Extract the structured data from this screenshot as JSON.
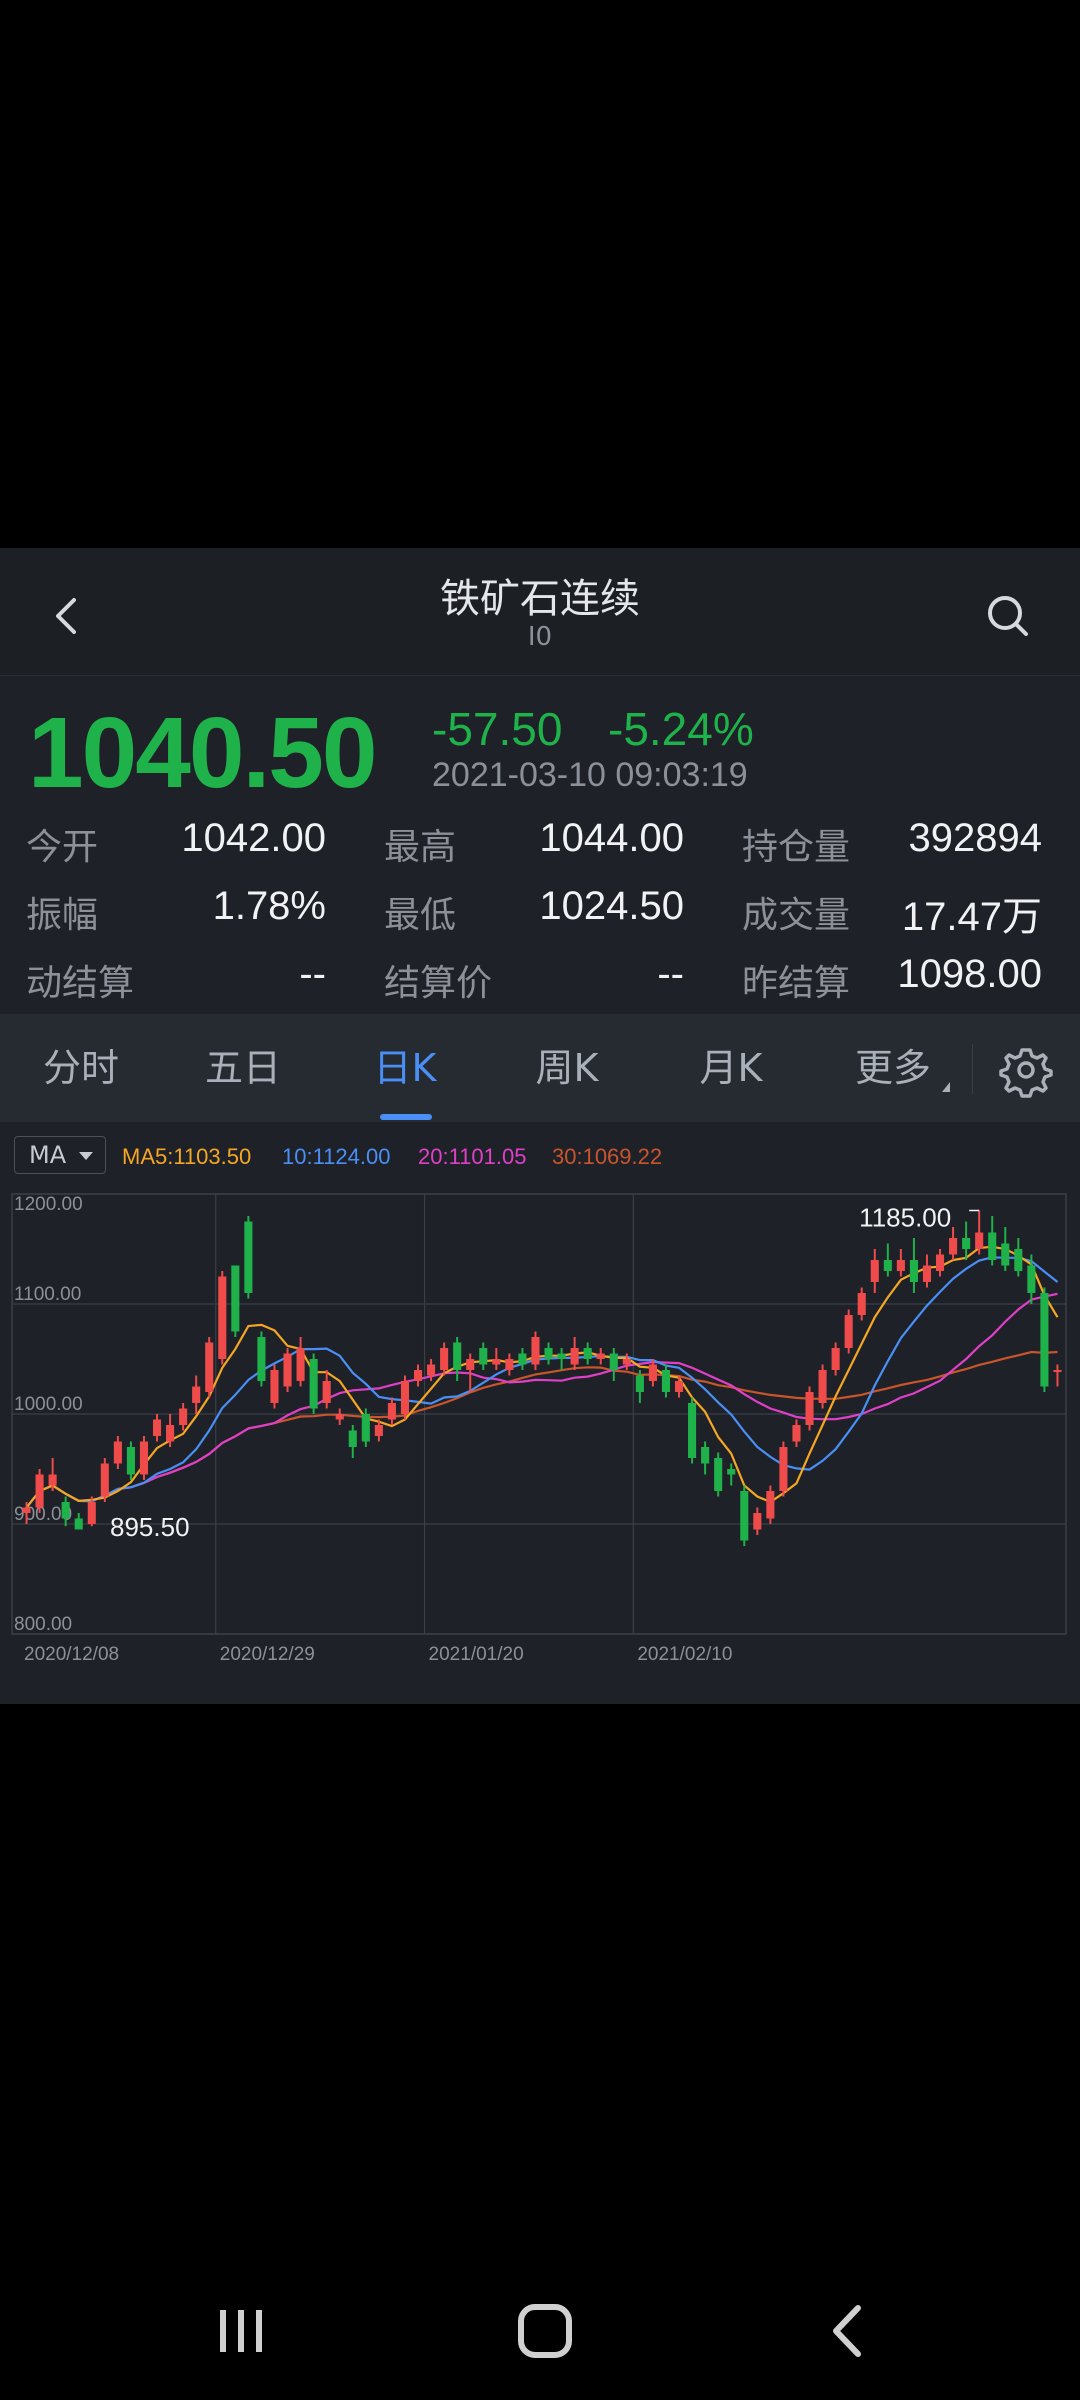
{
  "header": {
    "title": "铁矿石连续",
    "subtitle": "I0"
  },
  "quote": {
    "price": "1040.50",
    "change": "-57.50",
    "change_pct": "-5.24%",
    "time": "2021-03-10 09:03:19",
    "colors": {
      "down": "#1fb24a",
      "up": "#ef4b4b"
    },
    "stats": [
      [
        {
          "label": "今开",
          "value": "1042.00"
        },
        {
          "label": "最高",
          "value": "1044.00"
        },
        {
          "label": "持仓量",
          "value": "392894"
        }
      ],
      [
        {
          "label": "振幅",
          "value": "1.78%"
        },
        {
          "label": "最低",
          "value": "1024.50"
        },
        {
          "label": "成交量",
          "value": "17.47万"
        }
      ],
      [
        {
          "label": "动结算",
          "value": "--"
        },
        {
          "label": "结算价",
          "value": "--"
        },
        {
          "label": "昨结算",
          "value": "1098.00"
        }
      ]
    ]
  },
  "tabs": [
    "分时",
    "五日",
    "日K",
    "周K",
    "月K",
    "更多"
  ],
  "active_tab": "日K",
  "ma": {
    "selector": "MA",
    "legend": [
      {
        "text": "MA5:1103.50",
        "color": "#f5a623"
      },
      {
        "text": "10:1124.00",
        "color": "#4a8ff5"
      },
      {
        "text": "20:1101.05",
        "color": "#e040c8"
      },
      {
        "text": "30:1069.22",
        "color": "#c9552c"
      }
    ]
  },
  "chart_data": {
    "type": "candlestick",
    "ylim": [
      800,
      1200
    ],
    "y_ticks": [
      "1200.00",
      "1100.00",
      "1000.00",
      "900.00",
      "800.00"
    ],
    "x_ticks": [
      "2020/12/08",
      "2020/12/29",
      "2021/01/20",
      "2021/02/10"
    ],
    "high_label": "1185.00",
    "low_label": "895.50",
    "candles": [
      [
        910,
        915,
        900,
        920
      ],
      [
        915,
        945,
        910,
        950
      ],
      [
        935,
        945,
        930,
        960
      ],
      [
        920,
        905,
        898,
        925
      ],
      [
        905,
        895,
        895,
        910
      ],
      [
        900,
        920,
        898,
        925
      ],
      [
        925,
        955,
        920,
        960
      ],
      [
        955,
        975,
        950,
        980
      ],
      [
        970,
        945,
        940,
        975
      ],
      [
        945,
        975,
        940,
        980
      ],
      [
        980,
        995,
        975,
        1000
      ],
      [
        975,
        990,
        970,
        1000
      ],
      [
        990,
        1005,
        985,
        1010
      ],
      [
        1010,
        1025,
        1000,
        1035
      ],
      [
        1020,
        1065,
        1015,
        1070
      ],
      [
        1050,
        1125,
        1045,
        1130
      ],
      [
        1135,
        1075,
        1070,
        1135
      ],
      [
        1175,
        1110,
        1105,
        1180
      ],
      [
        1070,
        1030,
        1025,
        1075
      ],
      [
        1010,
        1040,
        1005,
        1045
      ],
      [
        1025,
        1055,
        1020,
        1060
      ],
      [
        1030,
        1060,
        1025,
        1070
      ],
      [
        1050,
        1005,
        1000,
        1055
      ],
      [
        1010,
        1030,
        1005,
        1040
      ],
      [
        995,
        1000,
        990,
        1005
      ],
      [
        985,
        970,
        960,
        990
      ],
      [
        1000,
        975,
        970,
        1005
      ],
      [
        980,
        990,
        975,
        995
      ],
      [
        995,
        1010,
        990,
        1015
      ],
      [
        1000,
        1030,
        995,
        1035
      ],
      [
        1030,
        1040,
        1025,
        1045
      ],
      [
        1035,
        1045,
        1030,
        1050
      ],
      [
        1040,
        1060,
        1035,
        1065
      ],
      [
        1065,
        1040,
        1030,
        1070
      ],
      [
        1040,
        1050,
        1020,
        1055
      ],
      [
        1060,
        1045,
        1040,
        1065
      ],
      [
        1045,
        1050,
        1040,
        1060
      ],
      [
        1040,
        1050,
        1035,
        1055
      ],
      [
        1055,
        1045,
        1040,
        1060
      ],
      [
        1045,
        1070,
        1040,
        1075
      ],
      [
        1060,
        1050,
        1045,
        1065
      ],
      [
        1055,
        1050,
        1040,
        1060
      ],
      [
        1045,
        1060,
        1040,
        1070
      ],
      [
        1060,
        1050,
        1045,
        1065
      ],
      [
        1050,
        1055,
        1045,
        1060
      ],
      [
        1055,
        1040,
        1030,
        1060
      ],
      [
        1045,
        1050,
        1040,
        1055
      ],
      [
        1035,
        1020,
        1010,
        1040
      ],
      [
        1030,
        1045,
        1025,
        1050
      ],
      [
        1040,
        1020,
        1015,
        1045
      ],
      [
        1020,
        1030,
        1015,
        1035
      ],
      [
        1010,
        960,
        955,
        1015
      ],
      [
        970,
        955,
        945,
        975
      ],
      [
        960,
        930,
        925,
        965
      ],
      [
        950,
        945,
        935,
        955
      ],
      [
        930,
        885,
        880,
        935
      ],
      [
        895,
        910,
        890,
        915
      ],
      [
        905,
        930,
        900,
        935
      ],
      [
        930,
        970,
        925,
        975
      ],
      [
        975,
        990,
        970,
        995
      ],
      [
        990,
        1020,
        985,
        1025
      ],
      [
        1010,
        1040,
        1005,
        1045
      ],
      [
        1040,
        1060,
        1035,
        1065
      ],
      [
        1060,
        1090,
        1055,
        1095
      ],
      [
        1090,
        1110,
        1085,
        1115
      ],
      [
        1120,
        1140,
        1110,
        1150
      ],
      [
        1140,
        1130,
        1125,
        1155
      ],
      [
        1130,
        1140,
        1125,
        1150
      ],
      [
        1140,
        1120,
        1110,
        1160
      ],
      [
        1120,
        1135,
        1115,
        1145
      ],
      [
        1130,
        1145,
        1125,
        1150
      ],
      [
        1145,
        1160,
        1140,
        1170
      ],
      [
        1160,
        1150,
        1140,
        1175
      ],
      [
        1150,
        1165,
        1145,
        1185
      ],
      [
        1165,
        1140,
        1135,
        1180
      ],
      [
        1155,
        1135,
        1130,
        1170
      ],
      [
        1150,
        1130,
        1125,
        1160
      ],
      [
        1135,
        1110,
        1100,
        1145
      ],
      [
        1110,
        1025,
        1020,
        1115
      ],
      [
        1040,
        1040,
        1025,
        1045
      ]
    ],
    "ma5_tail": 1103.5,
    "ma10_tail": 1124.0,
    "ma20_tail": 1101.05,
    "ma30_tail": 1069.22
  },
  "nav": [
    "recent-apps",
    "home",
    "back"
  ]
}
